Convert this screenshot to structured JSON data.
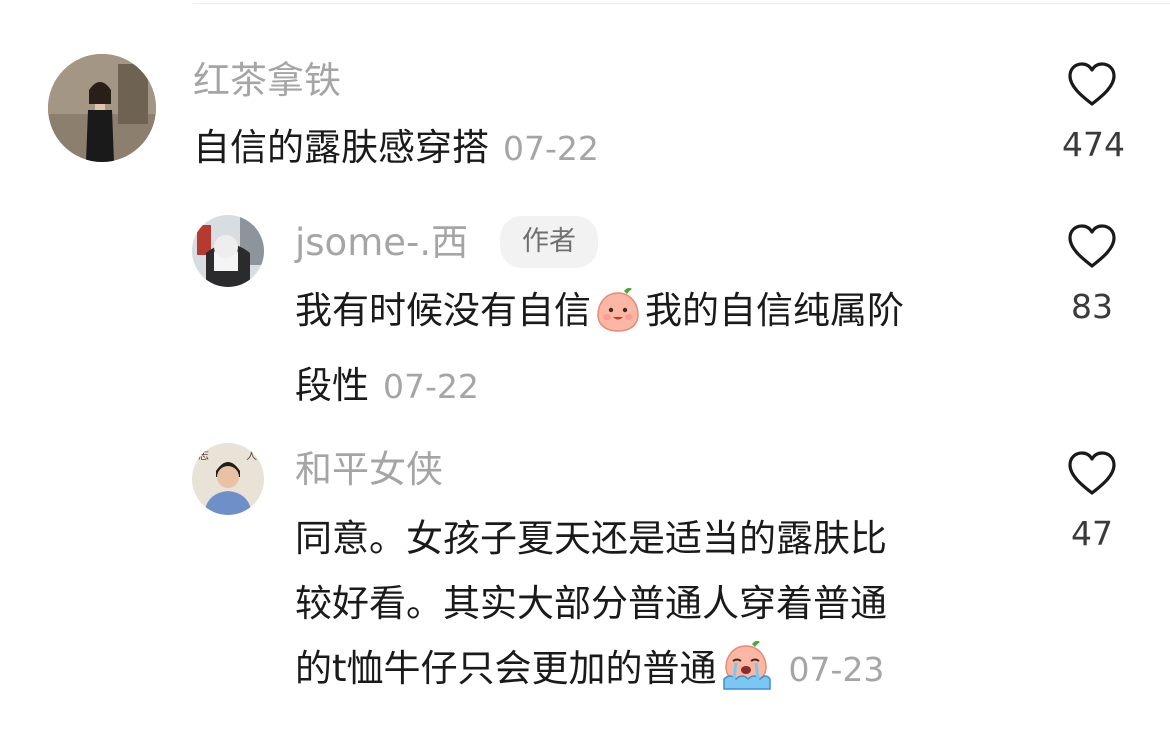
{
  "comments": [
    {
      "username": "红茶拿铁",
      "text": "自信的露肤感穿搭",
      "date": "07-22",
      "likes": "474"
    },
    {
      "username": "jsome-.西",
      "badge": "作者",
      "text_line1a": "我有时候没有自信",
      "text_line1b": "我的自信纯属阶",
      "text_line2": "段性",
      "date": "07-22",
      "likes": "83",
      "emoji": "smiling-peach-emoji"
    },
    {
      "username": "和平女侠",
      "text_line1": "同意。女孩子夏天还是适当的露肤比",
      "text_line2": "较好看。其实大部分普通人穿着普通",
      "text_line3": "的t恤牛仔只会更加的普通",
      "date": "07-23",
      "likes": "47",
      "emoji": "crying-peach-emoji"
    }
  ],
  "icons": {
    "like": "heart-outline-icon"
  },
  "colors": {
    "username": "#a5a5a5",
    "text": "#1a1a1a",
    "badge_bg": "#f2f2f2"
  }
}
